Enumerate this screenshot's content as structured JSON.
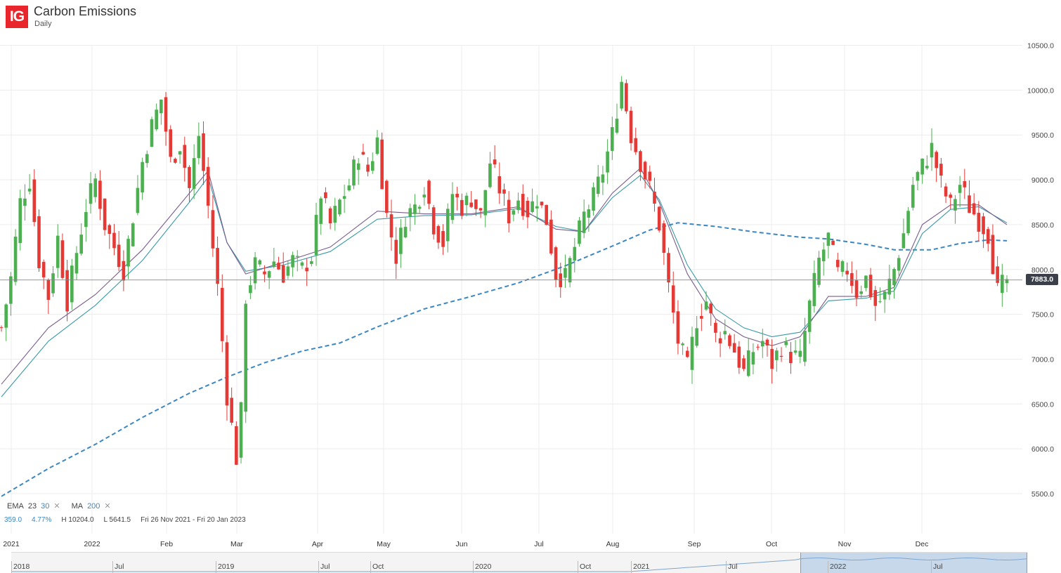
{
  "header": {
    "logo": "IG",
    "title": "Carbon Emissions",
    "subtitle": "Daily"
  },
  "indicators": {
    "ema_label": "EMA",
    "ema_short": "23",
    "ema_long": "30",
    "ma_label": "MA",
    "ma_period": "200",
    "close_icon": "close-x-icon"
  },
  "stats": {
    "change": "359.0",
    "change_pct": "4.77%",
    "high": "H 10204.0",
    "low": "L 5641.5",
    "range": "Fri 26 Nov 2021 - Fri 20 Jan 2023"
  },
  "last_price": "7883.0",
  "colors": {
    "up": "#4caf50",
    "down": "#e53935",
    "ema23": "#7a5c8c",
    "ema30": "#3a9aa6",
    "ma200": "#3b87c4",
    "accent": "#e8262b"
  },
  "navigator": {
    "labels": [
      "2018",
      "Jul",
      "2019",
      "Jul",
      "Oct",
      "2020",
      "Oct",
      "2021",
      "Jul",
      "2022",
      "Jul"
    ]
  },
  "chart_data": {
    "type": "candlestick",
    "title": "Carbon Emissions",
    "subtitle": "Daily",
    "y_ticks": [
      "5500.0",
      "6000.0",
      "6500.0",
      "7000.0",
      "7500.0",
      "8000.0",
      "8500.0",
      "9000.0",
      "9500.0",
      "10000.0",
      "10500.0"
    ],
    "ylim": [
      5100,
      10600
    ],
    "x_ticks": [
      "2021",
      "2022",
      "Feb",
      "Mar",
      "Apr",
      "May",
      "Jun",
      "Jul",
      "Aug",
      "Sep",
      "Oct",
      "Nov",
      "Dec"
    ],
    "last_price": 7883.0,
    "price_path": [
      [
        0,
        7350
      ],
      [
        2,
        7900
      ],
      [
        4,
        8750
      ],
      [
        6,
        9000
      ],
      [
        8,
        8100
      ],
      [
        10,
        7700
      ],
      [
        12,
        8350
      ],
      [
        14,
        7650
      ],
      [
        16,
        8200
      ],
      [
        18,
        8700
      ],
      [
        20,
        9000
      ],
      [
        22,
        8500
      ],
      [
        24,
        8250
      ],
      [
        26,
        8000
      ],
      [
        28,
        8600
      ],
      [
        30,
        9200
      ],
      [
        32,
        9600
      ],
      [
        34,
        9900
      ],
      [
        36,
        9200
      ],
      [
        38,
        9400
      ],
      [
        40,
        8900
      ],
      [
        42,
        9500
      ],
      [
        44,
        8700
      ],
      [
        46,
        7800
      ],
      [
        48,
        6600
      ],
      [
        50,
        5900
      ],
      [
        51,
        6400
      ],
      [
        52,
        7700
      ],
      [
        54,
        8050
      ],
      [
        56,
        7950
      ],
      [
        58,
        8100
      ],
      [
        60,
        7950
      ],
      [
        62,
        8100
      ],
      [
        64,
        8000
      ],
      [
        66,
        8150
      ],
      [
        68,
        8850
      ],
      [
        70,
        8500
      ],
      [
        72,
        8750
      ],
      [
        74,
        8950
      ],
      [
        76,
        9300
      ],
      [
        78,
        9100
      ],
      [
        80,
        9450
      ],
      [
        82,
        8600
      ],
      [
        84,
        8150
      ],
      [
        86,
        8600
      ],
      [
        88,
        8700
      ],
      [
        90,
        8950
      ],
      [
        92,
        8500
      ],
      [
        94,
        8300
      ],
      [
        96,
        8850
      ],
      [
        98,
        8700
      ],
      [
        100,
        8800
      ],
      [
        102,
        8600
      ],
      [
        104,
        9200
      ],
      [
        106,
        8900
      ],
      [
        108,
        8600
      ],
      [
        110,
        8800
      ],
      [
        112,
        8650
      ],
      [
        114,
        8800
      ],
      [
        116,
        8550
      ],
      [
        118,
        7950
      ],
      [
        120,
        7900
      ],
      [
        122,
        8250
      ],
      [
        124,
        8600
      ],
      [
        126,
        8800
      ],
      [
        128,
        9100
      ],
      [
        130,
        9500
      ],
      [
        132,
        10100
      ],
      [
        134,
        9500
      ],
      [
        136,
        9200
      ],
      [
        138,
        8900
      ],
      [
        140,
        8500
      ],
      [
        142,
        7800
      ],
      [
        144,
        7200
      ],
      [
        146,
        6900
      ],
      [
        148,
        7450
      ],
      [
        150,
        7650
      ],
      [
        152,
        7250
      ],
      [
        154,
        7300
      ],
      [
        156,
        7100
      ],
      [
        158,
        6850
      ],
      [
        160,
        7100
      ],
      [
        162,
        7200
      ],
      [
        164,
        6950
      ],
      [
        166,
        7150
      ],
      [
        168,
        7050
      ],
      [
        170,
        7000
      ],
      [
        172,
        7600
      ],
      [
        174,
        8100
      ],
      [
        176,
        8350
      ],
      [
        178,
        7950
      ],
      [
        180,
        8000
      ],
      [
        182,
        7750
      ],
      [
        184,
        7900
      ],
      [
        186,
        7600
      ],
      [
        188,
        7700
      ],
      [
        190,
        8000
      ],
      [
        192,
        8400
      ],
      [
        194,
        8950
      ],
      [
        196,
        9150
      ],
      [
        198,
        9350
      ],
      [
        200,
        8950
      ],
      [
        202,
        8700
      ],
      [
        204,
        8950
      ],
      [
        206,
        8700
      ],
      [
        208,
        8550
      ],
      [
        210,
        8400
      ],
      [
        212,
        7750
      ],
      [
        214,
        7883
      ]
    ],
    "ema23": [
      [
        0,
        6720
      ],
      [
        10,
        7350
      ],
      [
        20,
        7720
      ],
      [
        30,
        8220
      ],
      [
        40,
        8850
      ],
      [
        44,
        9100
      ],
      [
        48,
        8300
      ],
      [
        52,
        7950
      ],
      [
        60,
        8080
      ],
      [
        70,
        8250
      ],
      [
        80,
        8650
      ],
      [
        90,
        8620
      ],
      [
        100,
        8620
      ],
      [
        110,
        8700
      ],
      [
        118,
        8450
      ],
      [
        124,
        8420
      ],
      [
        130,
        8850
      ],
      [
        136,
        9130
      ],
      [
        140,
        8750
      ],
      [
        146,
        7950
      ],
      [
        152,
        7450
      ],
      [
        158,
        7250
      ],
      [
        164,
        7150
      ],
      [
        170,
        7250
      ],
      [
        176,
        7700
      ],
      [
        184,
        7700
      ],
      [
        190,
        7800
      ],
      [
        196,
        8500
      ],
      [
        202,
        8720
      ],
      [
        208,
        8720
      ],
      [
        214,
        8500
      ]
    ],
    "ema30": [
      [
        0,
        6580
      ],
      [
        10,
        7200
      ],
      [
        20,
        7600
      ],
      [
        30,
        8100
      ],
      [
        40,
        8750
      ],
      [
        44,
        9030
      ],
      [
        48,
        8300
      ],
      [
        52,
        7980
      ],
      [
        60,
        8050
      ],
      [
        70,
        8200
      ],
      [
        80,
        8560
      ],
      [
        90,
        8600
      ],
      [
        100,
        8610
      ],
      [
        110,
        8680
      ],
      [
        118,
        8480
      ],
      [
        124,
        8420
      ],
      [
        130,
        8800
      ],
      [
        136,
        9050
      ],
      [
        140,
        8780
      ],
      [
        146,
        8050
      ],
      [
        152,
        7560
      ],
      [
        158,
        7350
      ],
      [
        164,
        7250
      ],
      [
        170,
        7300
      ],
      [
        176,
        7650
      ],
      [
        184,
        7680
      ],
      [
        190,
        7760
      ],
      [
        196,
        8400
      ],
      [
        202,
        8670
      ],
      [
        208,
        8700
      ],
      [
        214,
        8520
      ]
    ],
    "ma200": [
      [
        0,
        5470
      ],
      [
        10,
        5780
      ],
      [
        20,
        6050
      ],
      [
        30,
        6350
      ],
      [
        40,
        6620
      ],
      [
        48,
        6800
      ],
      [
        56,
        6960
      ],
      [
        64,
        7090
      ],
      [
        72,
        7180
      ],
      [
        80,
        7360
      ],
      [
        90,
        7560
      ],
      [
        100,
        7700
      ],
      [
        110,
        7850
      ],
      [
        120,
        8040
      ],
      [
        130,
        8260
      ],
      [
        138,
        8440
      ],
      [
        144,
        8520
      ],
      [
        152,
        8480
      ],
      [
        160,
        8420
      ],
      [
        170,
        8360
      ],
      [
        176,
        8340
      ],
      [
        184,
        8280
      ],
      [
        190,
        8220
      ],
      [
        198,
        8220
      ],
      [
        204,
        8290
      ],
      [
        210,
        8330
      ],
      [
        214,
        8320
      ]
    ]
  }
}
